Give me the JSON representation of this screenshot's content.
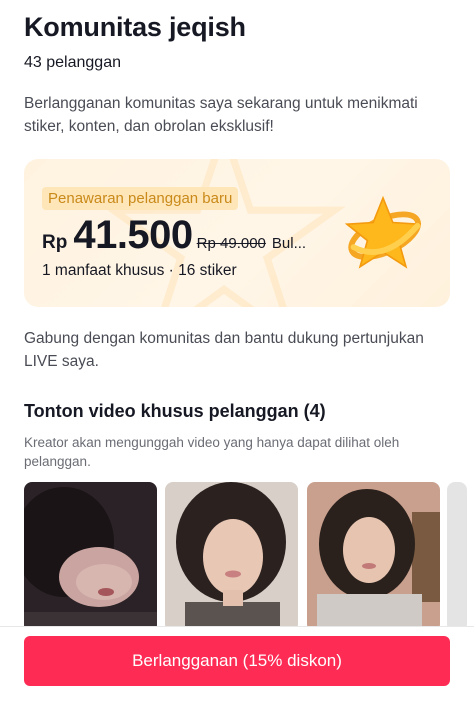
{
  "header": {
    "title": "Komunitas jeqish",
    "subscribers": "43 pelanggan"
  },
  "intro": "Berlangganan komunitas saya sekarang untuk menikmati stiker, konten, dan obrolan eksklusif!",
  "offer": {
    "tag": "Penawaran pelanggan baru",
    "currency": "Rp",
    "price": "41.500",
    "old_price": "Rp 49.000",
    "unit": "Bul...",
    "benefits": "1 manfaat khusus · 16 stiker"
  },
  "join_text": "Gabung dengan komunitas dan bantu dukung pertunjukan LIVE saya.",
  "videos": {
    "title": "Tonton video khusus pelanggan (4)",
    "description": "Kreator akan mengunggah video yang hanya dapat dilihat oleh pelanggan."
  },
  "cta": {
    "label": "Berlangganan (15% diskon)"
  },
  "colors": {
    "accent": "#fe2c55",
    "offer_tag": "#c98a1a",
    "offer_bg": "#fff3e0"
  }
}
